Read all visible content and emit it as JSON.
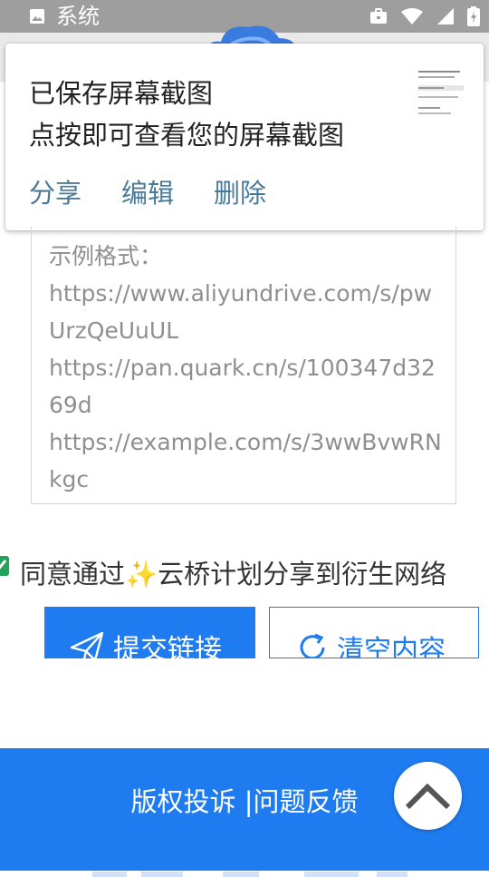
{
  "status_bar": {
    "title": "系统",
    "icons": [
      "image-icon",
      "briefcase-icon",
      "wifi-icon",
      "signal-icon",
      "battery-charging-icon"
    ]
  },
  "notification": {
    "title": "已保存屏幕截图",
    "subtitle": "点按即可查看您的屏幕截图",
    "actions": {
      "share": "分享",
      "edit": "编辑",
      "delete": "删除"
    }
  },
  "link_input": {
    "placeholder_lines": [
      "示例格式：",
      "https://www.aliyundrive.com/s/pwUrzQeUuUL",
      "https://pan.quark.cn/s/100347d3269d",
      "https://example.com/s/3wwBvwRNkgc"
    ]
  },
  "agreement": {
    "checked": true,
    "text_before": "同意通过",
    "sparkle": "✨",
    "text_after": "云桥计划分享到衍生网络"
  },
  "buttons": {
    "submit_label": "提交链接",
    "clear_label": "清空内容"
  },
  "footer": {
    "copyright_label": "版权投诉",
    "separator": " |",
    "feedback_label": "问题反馈"
  },
  "colors": {
    "accent": "#1e7cf0",
    "status_bar": "#9e9e9e",
    "check": "#22a35a",
    "notif_action": "#4a7a9a"
  }
}
